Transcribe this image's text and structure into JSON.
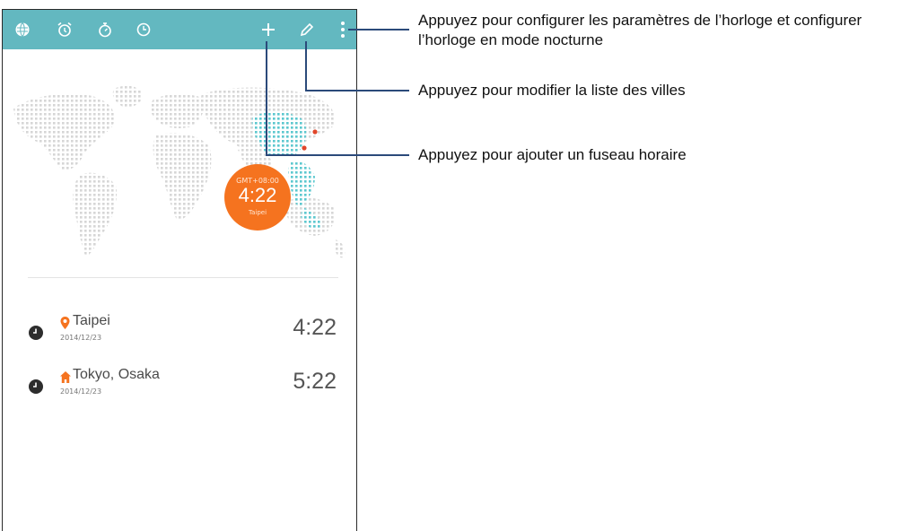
{
  "toolbar": {
    "icons": [
      "world-clock-icon",
      "alarm-icon",
      "stopwatch-icon",
      "timer-icon",
      "add-icon",
      "edit-icon",
      "menu-icon"
    ]
  },
  "map": {
    "badge_gmt": "GMT+08:00",
    "badge_time": "4:22",
    "badge_city": "Taipei"
  },
  "cities": [
    {
      "name": "Taipei",
      "date": "2014/12/23",
      "time": "4:22",
      "marker": "location-pin-icon"
    },
    {
      "name": "Tokyo, Osaka",
      "date": "2014/12/23",
      "time": "5:22",
      "marker": "home-icon"
    }
  ],
  "callouts": {
    "menu": "Appuyez pour configurer les paramètres de l’horloge et configurer l’horloge en mode nocturne",
    "edit": "Appuyez pour modifier la liste des villes",
    "add": "Appuyez pour ajouter un fuseau horaire"
  },
  "colors": {
    "toolbar": "#63b8c0",
    "accent": "#f5731f",
    "map_dots": "#d6d6d6",
    "map_highlight": "#5cc8cf",
    "callout_line": "#2b4a7a"
  }
}
